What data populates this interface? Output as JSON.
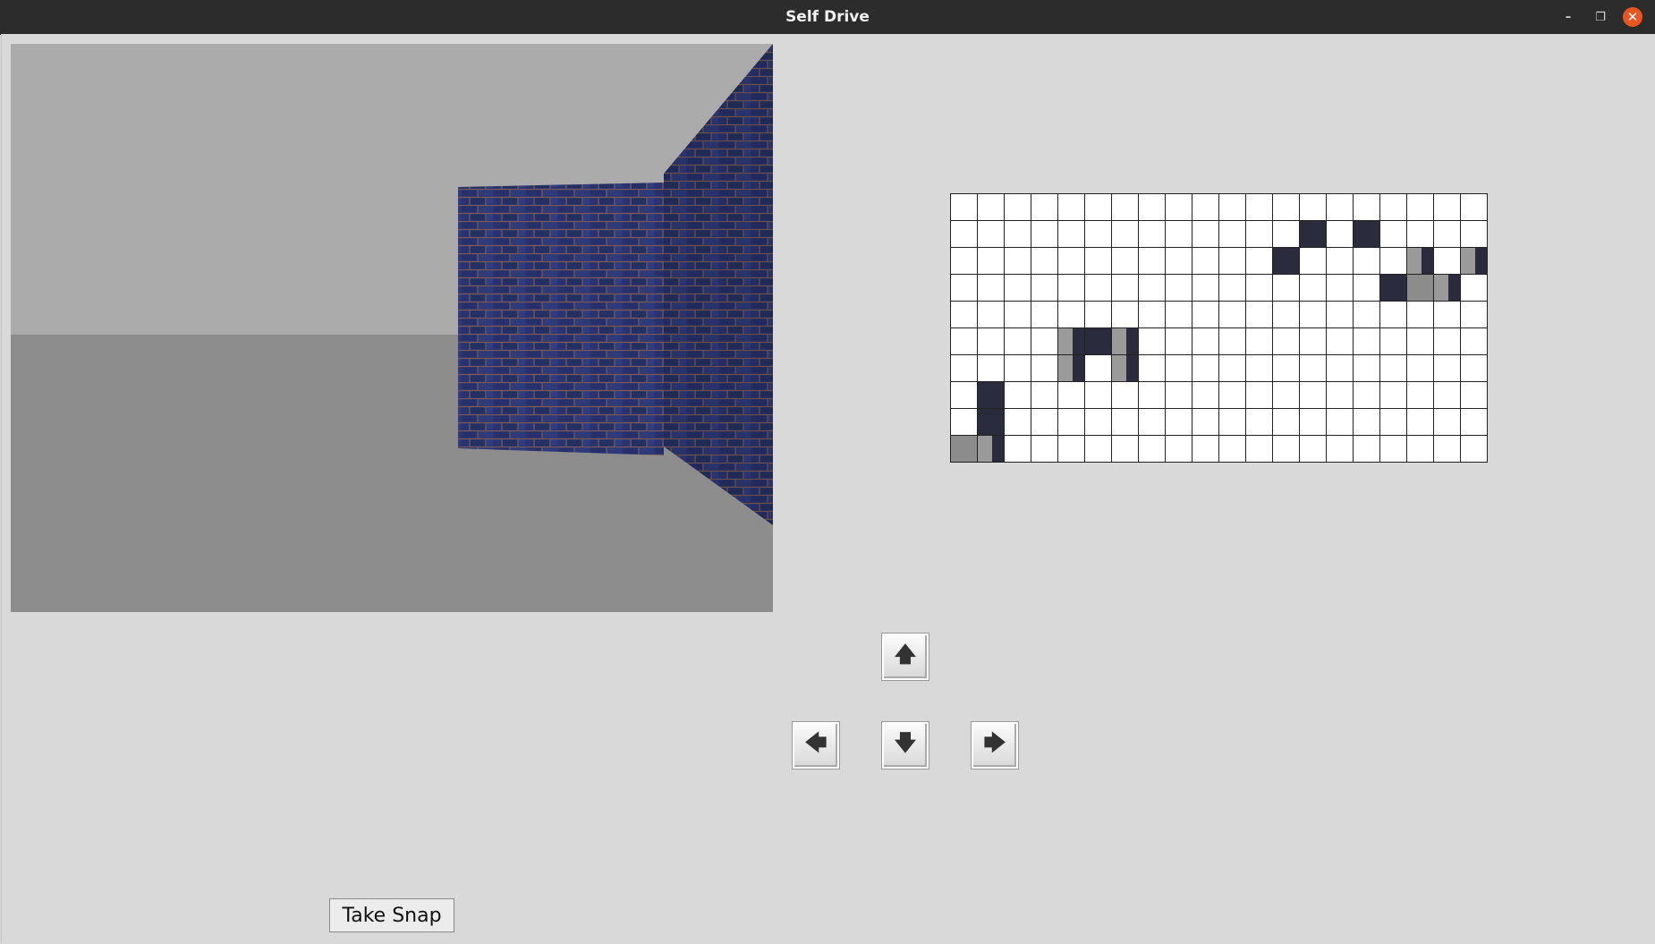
{
  "window": {
    "title": "Self Drive",
    "controls": [
      "minimize",
      "maximize",
      "close"
    ],
    "control_glyphs": [
      "–",
      "❐",
      "✕"
    ]
  },
  "minimap": {
    "cols": 20,
    "rows": 10,
    "walls": [
      {
        "r": 1,
        "c": 13,
        "t": "wall"
      },
      {
        "r": 1,
        "c": 15,
        "t": "wall"
      },
      {
        "r": 2,
        "c": 12,
        "t": "wall"
      },
      {
        "r": 2,
        "c": 17,
        "t": "wall-mix"
      },
      {
        "r": 2,
        "c": 19,
        "t": "wall-mix"
      },
      {
        "r": 3,
        "c": 16,
        "t": "wall"
      },
      {
        "r": 3,
        "c": 17,
        "t": "wall-gray"
      },
      {
        "r": 3,
        "c": 18,
        "t": "wall-mix"
      },
      {
        "r": 5,
        "c": 4,
        "t": "wall-mix"
      },
      {
        "r": 5,
        "c": 5,
        "t": "wall"
      },
      {
        "r": 5,
        "c": 6,
        "t": "wall-mix"
      },
      {
        "r": 6,
        "c": 4,
        "t": "wall-mix"
      },
      {
        "r": 6,
        "c": 6,
        "t": "wall-mix"
      },
      {
        "r": 7,
        "c": 1,
        "t": "wall"
      },
      {
        "r": 8,
        "c": 1,
        "t": "wall"
      },
      {
        "r": 9,
        "c": 0,
        "t": "wall-gray"
      },
      {
        "r": 9,
        "c": 1,
        "t": "wall-mix"
      }
    ]
  },
  "controls": {
    "up": "🡅",
    "left": "🡄",
    "down": "🡇",
    "right": "🡆"
  },
  "snap_button": "Take Snap"
}
